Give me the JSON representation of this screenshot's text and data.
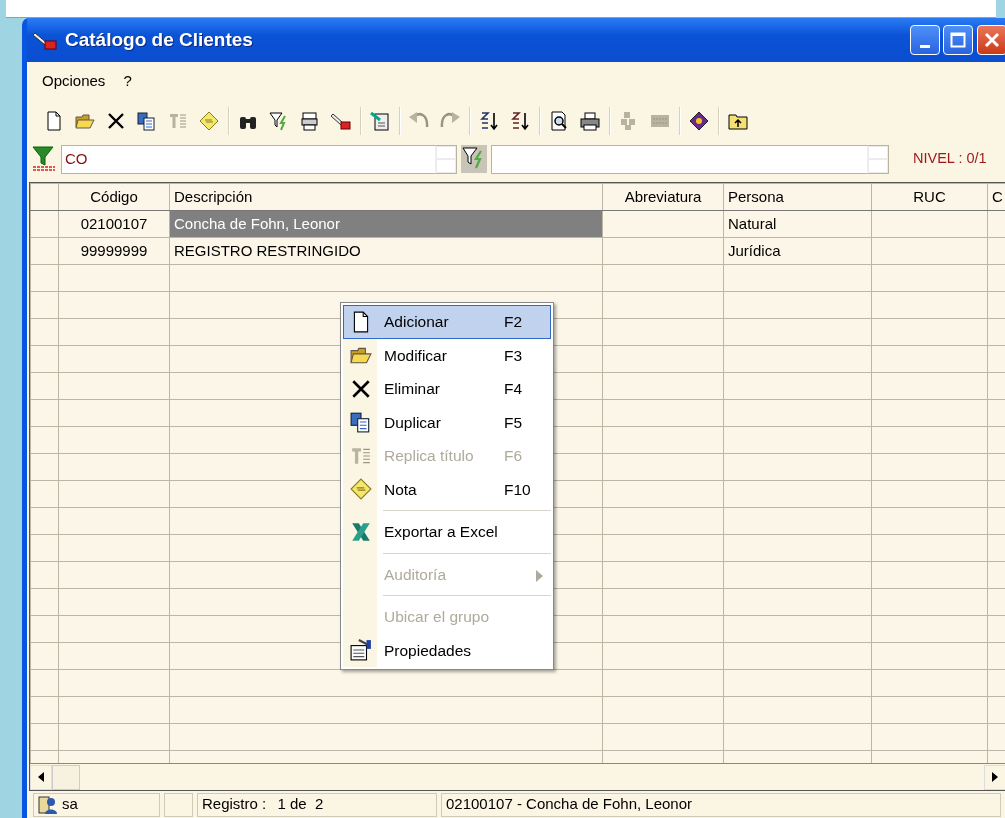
{
  "window": {
    "title": "Catálogo de Clientes"
  },
  "menu_bar": [
    {
      "label": "Opciones"
    },
    {
      "label": "?"
    }
  ],
  "toolbar": [
    [
      {
        "disabled": false
      },
      {
        "disabled": false
      },
      {
        "disabled": false
      },
      {
        "disabled": false
      },
      {
        "disabled": true
      },
      {
        "disabled": false
      }
    ],
    [
      {
        "disabled": false
      },
      {
        "disabled": false
      },
      {
        "disabled": false
      },
      {
        "disabled": false
      }
    ],
    [
      {
        "disabled": false
      }
    ],
    [
      {
        "disabled": true
      },
      {
        "disabled": true
      }
    ],
    [
      {
        "disabled": false
      },
      {
        "disabled": false
      }
    ],
    [
      {
        "disabled": false
      },
      {
        "disabled": false
      }
    ],
    [
      {
        "disabled": true
      },
      {
        "disabled": true
      }
    ],
    [
      {
        "disabled": false
      }
    ],
    [
      {
        "disabled": false
      }
    ]
  ],
  "filter_bar": {
    "search_value": "CO",
    "level": "NIVEL : 0/1"
  },
  "table": {
    "columns": [
      "Código",
      "Descripción",
      "Abreviatura",
      "Persona",
      "RUC",
      "C"
    ],
    "rows": [
      {
        "selected": true,
        "cells": [
          "02100107",
          "Concha de Fohn, Leonor",
          "",
          "Natural",
          "",
          ""
        ]
      },
      {
        "selected": false,
        "cells": [
          "99999999",
          "REGISTRO RESTRINGIDO",
          "",
          "Jurídica",
          "",
          ""
        ]
      }
    ]
  },
  "context_menu": [
    {
      "kind": "item",
      "label": "Adicionar",
      "shortcut": "F2",
      "selected": true,
      "disabled": false,
      "submenu": false
    },
    {
      "kind": "item",
      "label": "Modificar",
      "shortcut": "F3",
      "selected": false,
      "disabled": false,
      "submenu": false
    },
    {
      "kind": "item",
      "label": "Eliminar",
      "shortcut": "F4",
      "selected": false,
      "disabled": false,
      "submenu": false
    },
    {
      "kind": "item",
      "label": "Duplicar",
      "shortcut": "F5",
      "selected": false,
      "disabled": false,
      "submenu": false
    },
    {
      "kind": "item",
      "label": "Replica título",
      "shortcut": "F6",
      "selected": false,
      "disabled": true,
      "submenu": false
    },
    {
      "kind": "item",
      "label": "Nota",
      "shortcut": "F10",
      "selected": false,
      "disabled": false,
      "submenu": false
    },
    {
      "kind": "separator"
    },
    {
      "kind": "item",
      "label": "Exportar a Excel",
      "selected": false,
      "disabled": false,
      "submenu": false
    },
    {
      "kind": "separator"
    },
    {
      "kind": "item",
      "label": "Auditoría",
      "selected": false,
      "disabled": true,
      "submenu": true
    },
    {
      "kind": "separator"
    },
    {
      "kind": "item",
      "label": "Ubicar el grupo",
      "selected": false,
      "disabled": true,
      "submenu": false
    },
    {
      "kind": "item",
      "label": "Propiedades",
      "selected": false,
      "disabled": false,
      "submenu": false
    }
  ],
  "status_bar": {
    "user": "sa",
    "record_label": "Registro :",
    "record_value": "1 de  2",
    "current": "02100107 - Concha de Fohn, Leonor"
  }
}
